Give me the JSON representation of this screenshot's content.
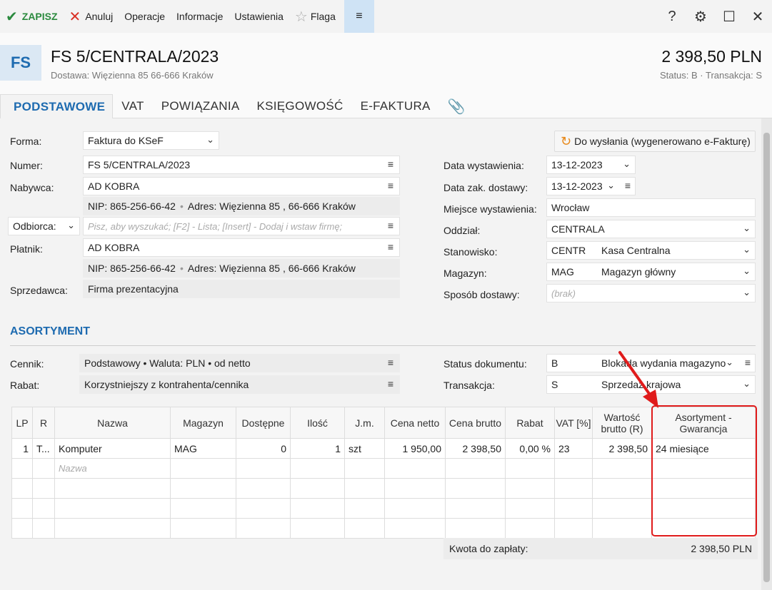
{
  "toolbar": {
    "save_label": "ZAPISZ",
    "cancel_label": "Anuluj",
    "operations_label": "Operacje",
    "info_label": "Informacje",
    "settings_label": "Ustawienia",
    "flag_label": "Flaga",
    "menu_icon": "≡"
  },
  "header": {
    "badge": "FS",
    "title": "FS 5/CENTRALA/2023",
    "subtitle": "Dostawa: Więzienna  85  66-666 Kraków",
    "amount": "2 398,50 PLN",
    "status": "Status:  B   ·  Transakcja:  S"
  },
  "tabs": [
    {
      "label": "PODSTAWOWE"
    },
    {
      "label": "VAT"
    },
    {
      "label": "POWIĄZANIA"
    },
    {
      "label": "KSIĘGOWOŚĆ"
    },
    {
      "label": "E-FAKTURA"
    }
  ],
  "form": {
    "forma_label": "Forma:",
    "forma_value": "Faktura do KSeF",
    "send_button": "Do wysłania (wygenerowano e-Fakturę)",
    "numer_label": "Numer:",
    "numer_value": "FS 5/CENTRALA/2023",
    "nabywca_label": "Nabywca:",
    "nabywca_value": "AD KOBRA",
    "nabywca_nip": "NIP:  865-256-66-42",
    "nabywca_address": "Adres:  Więzienna  85 , 66-666 Kraków",
    "odbiorca_label": "Odbiorca:",
    "odbiorca_placeholder": "Pisz, aby wyszukać; [F2] - Lista; [Insert] - Dodaj i wstaw firmę;",
    "platnik_label": "Płatnik:",
    "platnik_value": "AD KOBRA",
    "platnik_nip": "NIP:  865-256-66-42",
    "platnik_address": "Adres:  Więzienna  85 , 66-666 Kraków",
    "sprzedawca_label": "Sprzedawca:",
    "sprzedawca_value": "Firma prezentacyjna",
    "data_wyst_label": "Data wystawienia:",
    "data_wyst_value": "13-12-2023",
    "data_dost_label": "Data zak. dostawy:",
    "data_dost_value": "13-12-2023",
    "miejsce_label": "Miejsce wystawienia:",
    "miejsce_value": "Wrocław",
    "oddzial_label": "Oddział:",
    "oddzial_value": "CENTRALA",
    "stanowisko_label": "Stanowisko:",
    "stanowisko_code": "CENTR",
    "stanowisko_name": "Kasa Centralna",
    "magazyn_label": "Magazyn:",
    "magazyn_code": "MAG",
    "magazyn_name": "Magazyn główny",
    "sposob_label": "Sposób dostawy:",
    "sposob_value": "(brak)"
  },
  "asortyment": {
    "title": "ASORTYMENT",
    "cennik_label": "Cennik:",
    "cennik_value": "Podstawowy • Waluta: PLN • od netto",
    "rabat_label": "Rabat:",
    "rabat_value": "Korzystniejszy z kontrahenta/cennika",
    "status_label": "Status dokumentu:",
    "status_code": "B",
    "status_name": "Blokada wydania magazyno",
    "transakcja_label": "Transakcja:",
    "transakcja_code": "S",
    "transakcja_name": "Sprzedaż krajowa"
  },
  "table": {
    "headers": [
      "LP",
      "R",
      "Nazwa",
      "Magazyn",
      "Dostępne",
      "Ilość",
      "J.m.",
      "Cena netto",
      "Cena brutto",
      "Rabat",
      "VAT [%]",
      "Wartość brutto (R)",
      "Asortyment - Gwarancja"
    ],
    "rows": [
      {
        "lp": "1",
        "r": "T...",
        "nazwa": "Komputer",
        "magazyn": "MAG",
        "dostepne": "0",
        "ilosc": "1",
        "jm": "szt",
        "cena_netto": "1 950,00",
        "cena_brutto": "2 398,50",
        "rabat": "0,00 %",
        "vat": "23",
        "wartosc": "2 398,50",
        "gwarancja": "24 miesiące"
      }
    ],
    "new_row_placeholder": "Nazwa"
  },
  "total": {
    "label": "Kwota do zapłaty:",
    "value": "2 398,50 PLN"
  }
}
